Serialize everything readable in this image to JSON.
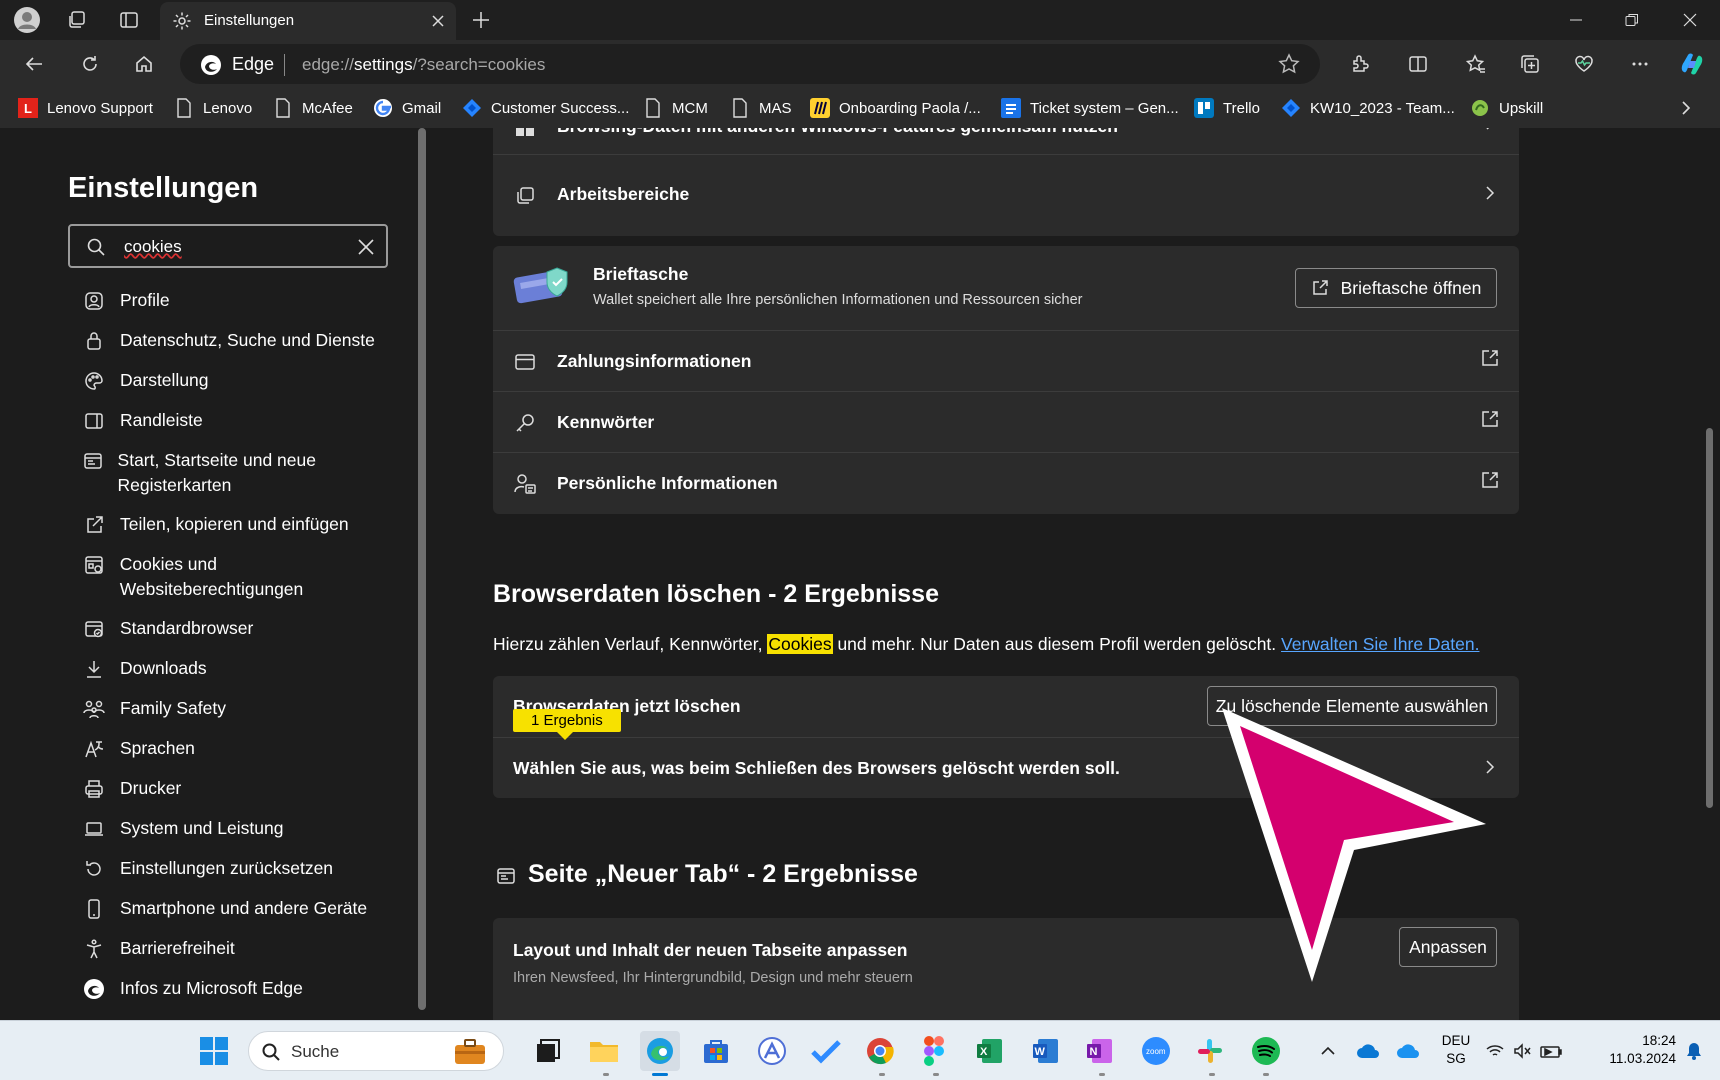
{
  "tab": {
    "title": "Einstellungen"
  },
  "address": {
    "site": "Edge",
    "url_prefix": "edge://",
    "url_host": "settings",
    "url_rest": "/?search=cookies"
  },
  "bookmarks": [
    {
      "label": "Lenovo Support",
      "icon": "lenovo-icon"
    },
    {
      "label": "Lenovo",
      "icon": "page-icon"
    },
    {
      "label": "McAfee",
      "icon": "page-icon"
    },
    {
      "label": "Gmail",
      "icon": "google-icon"
    },
    {
      "label": "Customer Success...",
      "icon": "jira-icon"
    },
    {
      "label": "MCM",
      "icon": "page-icon"
    },
    {
      "label": "MAS",
      "icon": "page-icon"
    },
    {
      "label": "Onboarding Paola /...",
      "icon": "miro-icon"
    },
    {
      "label": "Ticket system – Gen...",
      "icon": "forms-icon"
    },
    {
      "label": "Trello",
      "icon": "trello-icon"
    },
    {
      "label": "KW10_2023 - Team...",
      "icon": "jira-icon"
    },
    {
      "label": "Upskill",
      "icon": "upskill-icon"
    }
  ],
  "sidebar": {
    "title": "Einstellungen",
    "search_value": "cookies",
    "items": [
      {
        "label": "Profile",
        "icon": "profile-icon"
      },
      {
        "label": "Datenschutz, Suche und Dienste",
        "icon": "lock-icon"
      },
      {
        "label": "Darstellung",
        "icon": "palette-icon"
      },
      {
        "label": "Randleiste",
        "icon": "sidebar-icon"
      },
      {
        "label": "Start, Startseite und neue Registerkarten",
        "icon": "home-page-icon"
      },
      {
        "label": "Teilen, kopieren und einfügen",
        "icon": "share-icon"
      },
      {
        "label": "Cookies und Websiteberechtigungen",
        "icon": "cookies-icon"
      },
      {
        "label": "Standardbrowser",
        "icon": "default-browser-icon"
      },
      {
        "label": "Downloads",
        "icon": "download-icon"
      },
      {
        "label": "Family Safety",
        "icon": "family-icon"
      },
      {
        "label": "Sprachen",
        "icon": "language-icon"
      },
      {
        "label": "Drucker",
        "icon": "printer-icon"
      },
      {
        "label": "System und Leistung",
        "icon": "laptop-icon"
      },
      {
        "label": "Einstellungen zurücksetzen",
        "icon": "reset-icon"
      },
      {
        "label": "Smartphone und andere Geräte",
        "icon": "phone-icon"
      },
      {
        "label": "Barrierefreiheit",
        "icon": "accessibility-icon"
      },
      {
        "label": "Infos zu Microsoft Edge",
        "icon": "edge-icon"
      }
    ]
  },
  "main": {
    "profile_rows": [
      {
        "label": "Browsing-Daten mit anderen Windows-Features gemeinsam nutzen",
        "icon": "windows-icon"
      },
      {
        "label": "Arbeitsbereiche",
        "icon": "workspaces-icon"
      }
    ],
    "wallet": {
      "title": "Brieftasche",
      "desc": "Wallet speichert alle Ihre persönlichen Informationen und Ressourcen sicher",
      "button": "Brieftasche öffnen"
    },
    "wallet_rows": [
      {
        "label": "Zahlungsinformationen",
        "icon": "card-icon"
      },
      {
        "label": "Kennwörter",
        "icon": "key-icon"
      },
      {
        "label": "Persönliche Informationen",
        "icon": "person-info-icon"
      }
    ],
    "clear": {
      "title": "Browserdaten löschen - 2 Ergebnisse",
      "desc_before": "Hierzu zählen Verlauf, Kennwörter,",
      "desc_highlight": "Cookies",
      "desc_after": "und mehr. Nur Daten aus diesem Profil werden gelöscht.",
      "desc_link": "Verwalten Sie Ihre Daten.",
      "row1_label": "Browserdaten jetzt löschen",
      "row1_badge": "1 Ergebnis",
      "row1_button": "Zu löschende Elemente auswählen",
      "row2_label": "Wählen Sie aus, was beim Schließen des Browsers gelöscht werden soll."
    },
    "newtab": {
      "title": "Seite „Neuer Tab“ - 2 Ergebnisse",
      "row_label": "Layout und Inhalt der neuen Tabseite anpassen",
      "row_desc": "Ihren Newsfeed, Ihr Hintergrundbild, Design und mehr steuern",
      "button": "Anpassen"
    }
  },
  "taskbar": {
    "search_label": "Suche",
    "lang_line1": "DEU",
    "lang_line2": "SG",
    "time": "18:24",
    "date": "11.03.2024"
  },
  "colors": {
    "highlight": "#f7e100",
    "link": "#58a6ff",
    "cursor": "#d4006e",
    "accent": "#0078d4"
  }
}
